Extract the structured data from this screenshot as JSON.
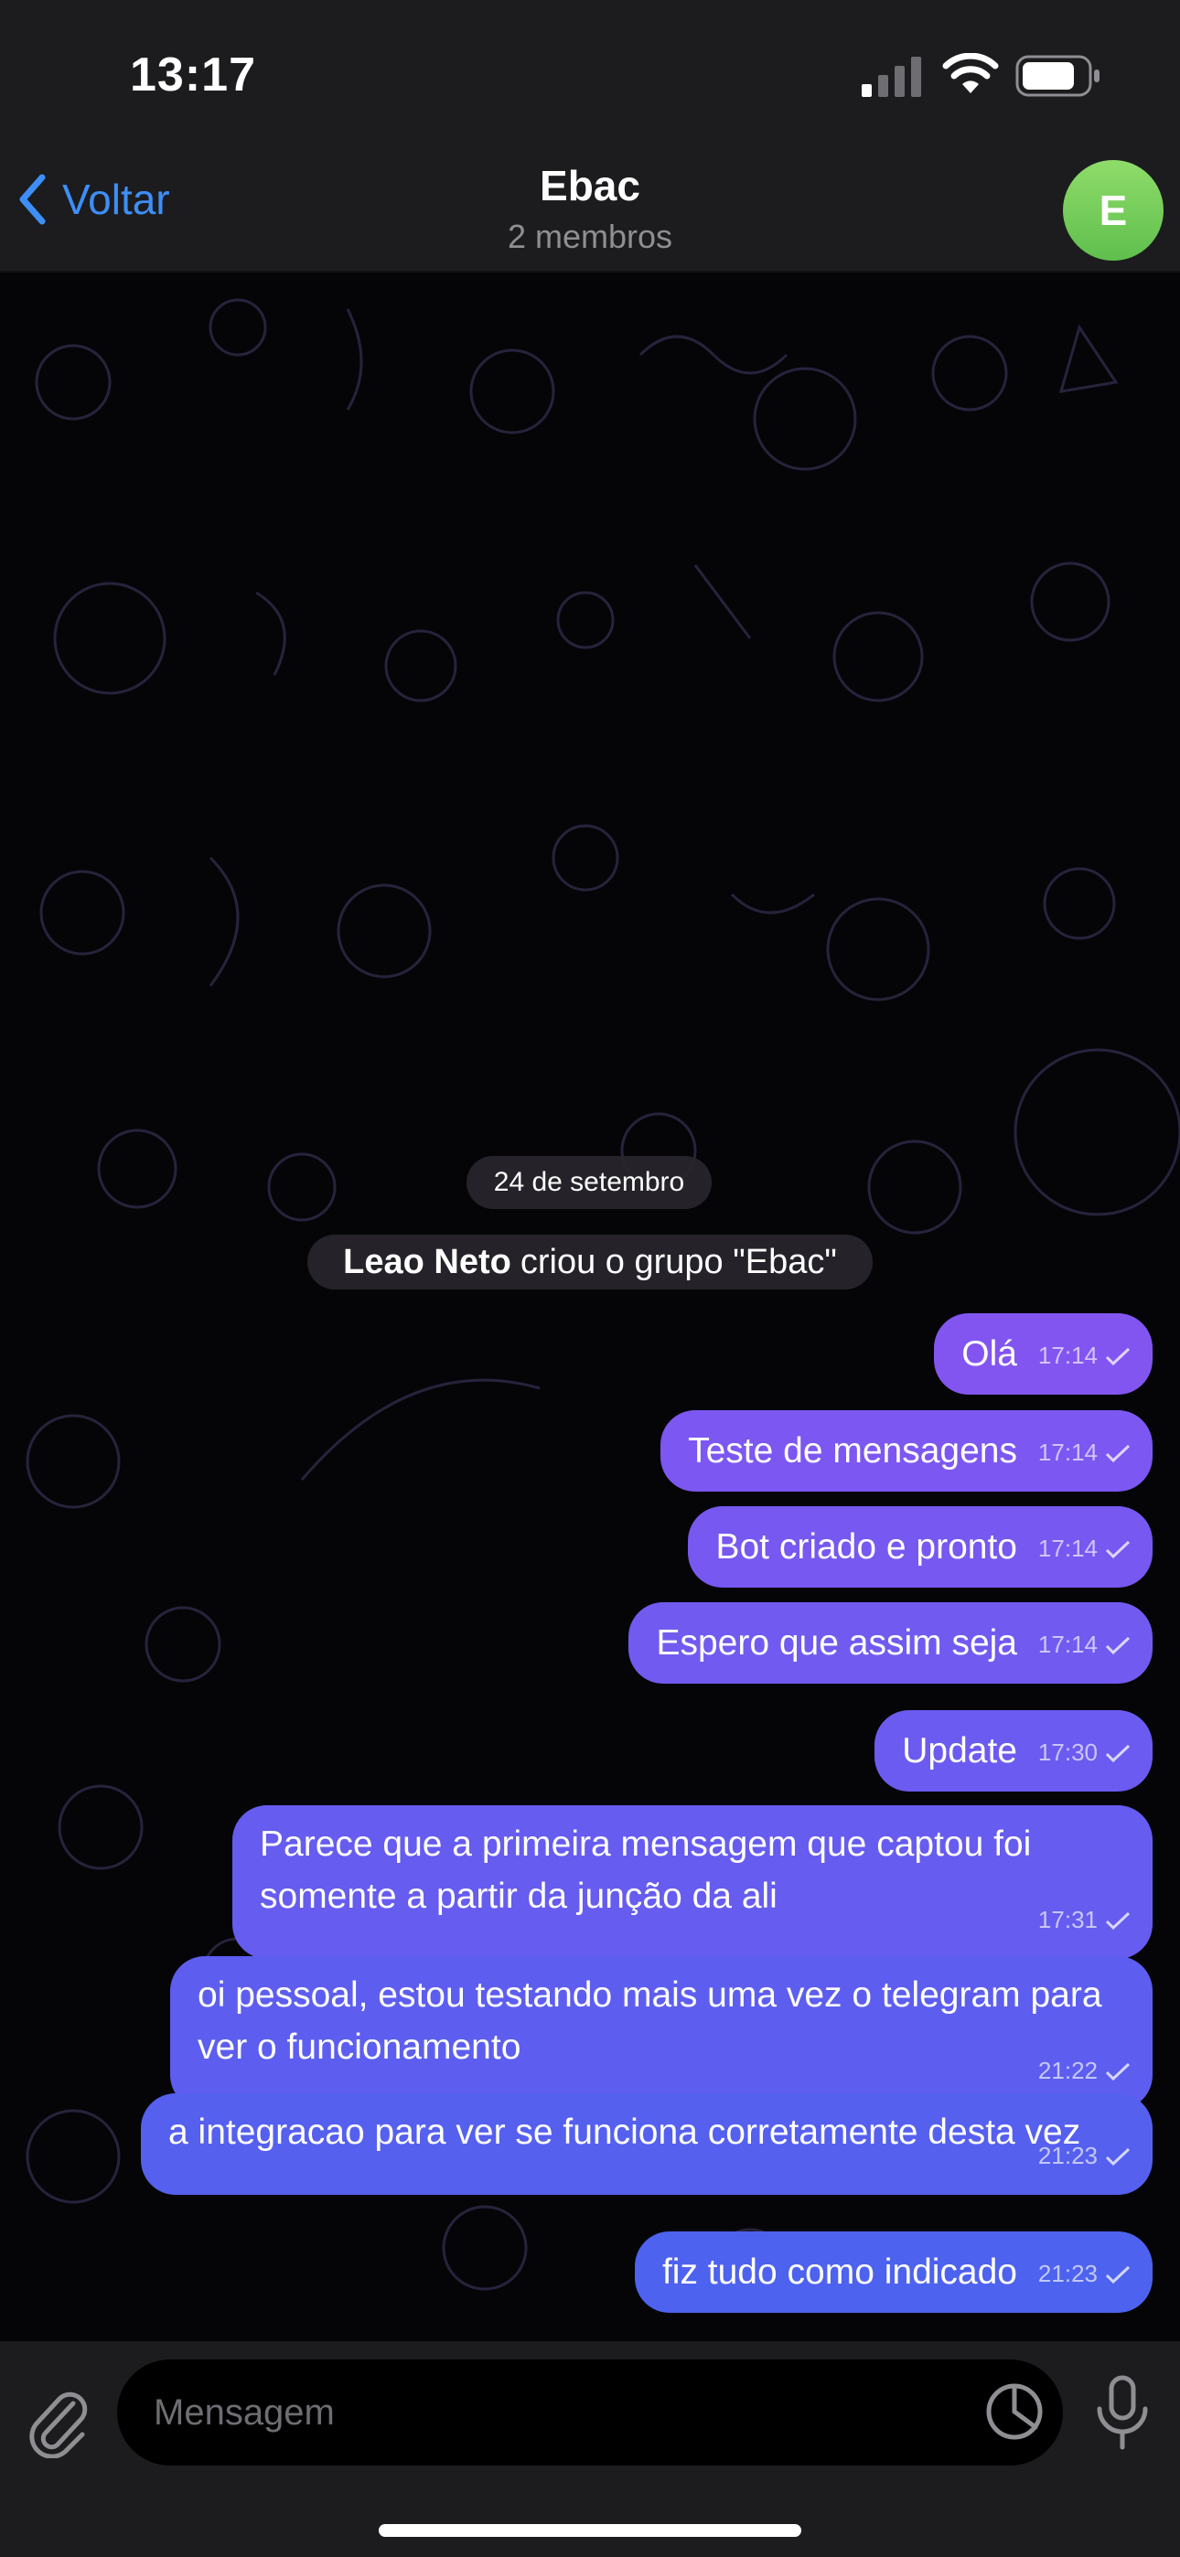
{
  "status": {
    "time": "13:17"
  },
  "nav": {
    "back_label": "Voltar",
    "title": "Ebac",
    "subtitle": "2 membros",
    "avatar_letter": "E"
  },
  "chat": {
    "date_label": "24 de setembro",
    "service": {
      "author": "Leao Neto",
      "text": "criou o grupo \"Ebac\""
    },
    "messages": [
      {
        "text": "Olá",
        "time": "17:14"
      },
      {
        "text": "Teste de mensagens",
        "time": "17:14"
      },
      {
        "text": "Bot criado e pronto",
        "time": "17:14"
      },
      {
        "text": "Espero que assim seja",
        "time": "17:14"
      },
      {
        "text": "Update",
        "time": "17:30"
      },
      {
        "text": "Parece que a primeira mensagem que captou foi somente a partir da junção da ali",
        "time": "17:31"
      },
      {
        "text": "oi pessoal, estou testando mais uma vez o telegram para ver o funcionamento",
        "time": "21:22"
      },
      {
        "text": "a integracao para ver se funciona corretamente desta vez",
        "time": "21:23"
      },
      {
        "text": "fiz tudo como indicado",
        "time": "21:23"
      }
    ]
  },
  "composer": {
    "placeholder": "Mensagem"
  },
  "colors": {
    "accent": "#3e8ef7",
    "bubble_top": "#8455f1",
    "bubble_bottom": "#4a63ee",
    "avatar": "#6cc85a"
  }
}
